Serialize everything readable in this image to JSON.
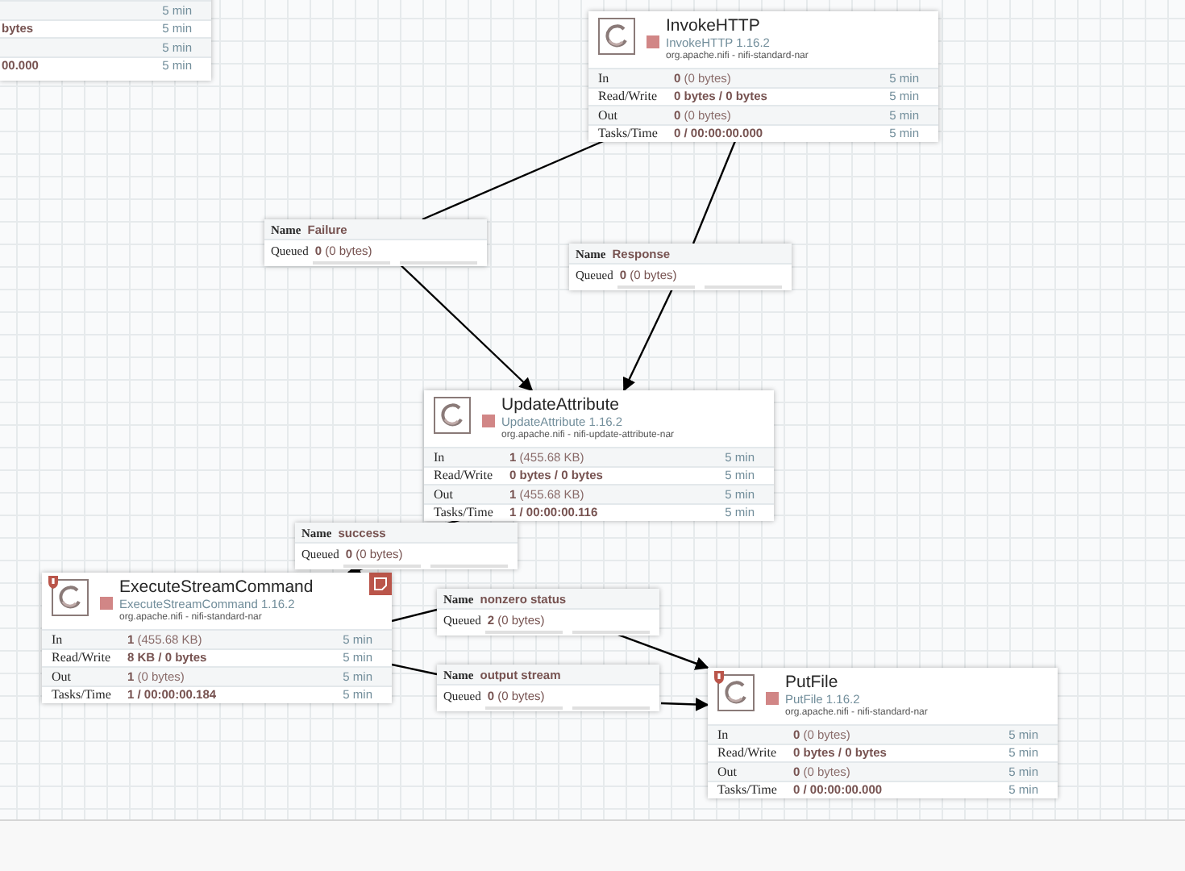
{
  "partial_processor": {
    "rows": [
      {
        "duration": "5 min"
      },
      {
        "value": "bytes",
        "duration": "5 min"
      },
      {
        "duration": "5 min"
      },
      {
        "value": "00.000",
        "duration": "5 min"
      }
    ]
  },
  "processors": [
    {
      "name": "InvokeHTTP",
      "type": "InvokeHTTP 1.16.2",
      "bundle": "org.apache.nifi - nifi-standard-nar",
      "stopped": true,
      "restricted": false,
      "bulletin": false,
      "stats": [
        {
          "label": "In",
          "value": "0",
          "detail": "(0 bytes)",
          "duration": "5 min"
        },
        {
          "label": "Read/Write",
          "value": "0 bytes / 0 bytes",
          "duration": "5 min"
        },
        {
          "label": "Out",
          "value": "0",
          "detail": "(0 bytes)",
          "duration": "5 min"
        },
        {
          "label": "Tasks/Time",
          "value": "0 / 00:00:00.000",
          "duration": "5 min"
        }
      ]
    },
    {
      "name": "UpdateAttribute",
      "type": "UpdateAttribute 1.16.2",
      "bundle": "org.apache.nifi - nifi-update-attribute-nar",
      "stopped": true,
      "restricted": false,
      "bulletin": false,
      "stats": [
        {
          "label": "In",
          "value": "1",
          "detail": "(455.68 KB)",
          "duration": "5 min"
        },
        {
          "label": "Read/Write",
          "value": "0 bytes / 0 bytes",
          "duration": "5 min"
        },
        {
          "label": "Out",
          "value": "1",
          "detail": "(455.68 KB)",
          "duration": "5 min"
        },
        {
          "label": "Tasks/Time",
          "value": "1 / 00:00:00.116",
          "duration": "5 min"
        }
      ]
    },
    {
      "name": "ExecuteStreamCommand",
      "type": "ExecuteStreamCommand 1.16.2",
      "bundle": "org.apache.nifi - nifi-standard-nar",
      "stopped": true,
      "restricted": true,
      "bulletin": true,
      "stats": [
        {
          "label": "In",
          "value": "1",
          "detail": "(455.68 KB)",
          "duration": "5 min"
        },
        {
          "label": "Read/Write",
          "value": "8 KB / 0 bytes",
          "duration": "5 min"
        },
        {
          "label": "Out",
          "value": "1",
          "detail": "(0 bytes)",
          "duration": "5 min"
        },
        {
          "label": "Tasks/Time",
          "value": "1 / 00:00:00.184",
          "duration": "5 min"
        }
      ]
    },
    {
      "name": "PutFile",
      "type": "PutFile 1.16.2",
      "bundle": "org.apache.nifi - nifi-standard-nar",
      "stopped": true,
      "restricted": true,
      "bulletin": false,
      "stats": [
        {
          "label": "In",
          "value": "0",
          "detail": "(0 bytes)",
          "duration": "5 min"
        },
        {
          "label": "Read/Write",
          "value": "0 bytes / 0 bytes",
          "duration": "5 min"
        },
        {
          "label": "Out",
          "value": "0",
          "detail": "(0 bytes)",
          "duration": "5 min"
        },
        {
          "label": "Tasks/Time",
          "value": "0 / 00:00:00.000",
          "duration": "5 min"
        }
      ]
    }
  ],
  "connections": [
    {
      "name_label": "Name",
      "name": "Failure",
      "queued_label": "Queued",
      "count": "0",
      "detail": "(0 bytes)"
    },
    {
      "name_label": "Name",
      "name": "Response",
      "queued_label": "Queued",
      "count": "0",
      "detail": "(0 bytes)"
    },
    {
      "name_label": "Name",
      "name": "success",
      "queued_label": "Queued",
      "count": "0",
      "detail": "(0 bytes)"
    },
    {
      "name_label": "Name",
      "name": "nonzero status",
      "queued_label": "Queued",
      "count": "2",
      "detail": "(0 bytes)"
    },
    {
      "name_label": "Name",
      "name": "output stream",
      "queued_label": "Queued",
      "count": "0",
      "detail": "(0 bytes)"
    }
  ]
}
